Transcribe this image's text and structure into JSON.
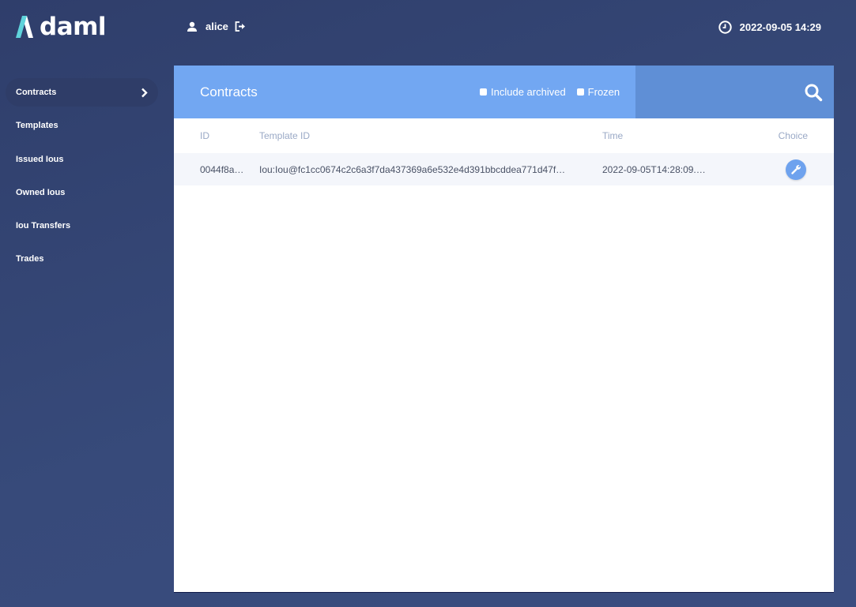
{
  "header": {
    "logo_text": "daml",
    "user": {
      "name": "alice",
      "icon": "user-icon",
      "logout_icon": "logout-icon"
    },
    "clock": {
      "icon": "clock-icon",
      "time": "2022-09-05 14:29"
    }
  },
  "sidebar": {
    "items": [
      {
        "label": "Contracts",
        "active": true
      },
      {
        "label": "Templates"
      },
      {
        "label": "Issued Ious"
      },
      {
        "label": "Owned Ious"
      },
      {
        "label": "Iou Transfers"
      },
      {
        "label": "Trades"
      }
    ]
  },
  "panel": {
    "title": "Contracts",
    "filters": {
      "include_archived": "Include archived",
      "frozen": "Frozen"
    },
    "search_icon": "search-icon",
    "columns": {
      "id": "ID",
      "template_id": "Template ID",
      "time": "Time",
      "choice": "Choice"
    },
    "rows": [
      {
        "id": "0044f8a…",
        "template_id": "Iou:Iou@fc1cc0674c2c6a3f7da437369a6e532e4d391bbcddea771d47f…",
        "time": "2022-09-05T14:28:09.…",
        "choice_icon": "wrench-icon"
      }
    ]
  },
  "colors": {
    "accent": "#72a7f2",
    "accent_dark": "#5f8fd6",
    "background": "#34457a"
  }
}
